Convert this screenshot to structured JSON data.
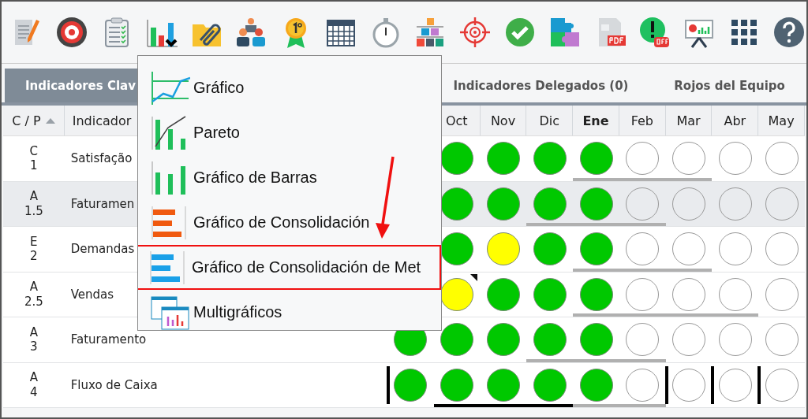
{
  "tabs": [
    {
      "label": "Indicadores Clav",
      "selected": true
    },
    {
      "label": "Indicadores Delegados (0)",
      "selected": false
    },
    {
      "label": "Rojos del Equipo",
      "selected": false
    }
  ],
  "table": {
    "columns": [
      {
        "label": "C / P",
        "sorted": true
      },
      {
        "label": "Indicador",
        "sorted": false
      }
    ],
    "months": [
      {
        "label": "Oct",
        "current": false
      },
      {
        "label": "Nov",
        "current": false
      },
      {
        "label": "Dic",
        "current": false
      },
      {
        "label": "Ene",
        "current": true
      },
      {
        "label": "Feb",
        "current": false
      },
      {
        "label": "Mar",
        "current": false
      },
      {
        "label": "Abr",
        "current": false
      },
      {
        "label": "May",
        "current": false
      }
    ],
    "rows": [
      {
        "category": "C",
        "priority": "1",
        "indicator": "Satisfação",
        "selected": false,
        "cells": [
          {
            "filled": true,
            "color": "#00c800"
          },
          {
            "filled": true,
            "color": "#00c800"
          },
          {
            "filled": true,
            "color": "#00c800"
          },
          {
            "filled": true,
            "color": "#00c800",
            "underline": true
          },
          {
            "filled": false,
            "underline": true
          },
          {
            "filled": false,
            "underline": true
          },
          {
            "filled": false
          },
          {
            "filled": false
          }
        ]
      },
      {
        "category": "A",
        "priority": "1.5",
        "indicator": "Faturamen",
        "selected": true,
        "cells": [
          {
            "filled": true,
            "color": "#00c800"
          },
          {
            "filled": true,
            "color": "#00c800"
          },
          {
            "filled": true,
            "color": "#00c800",
            "underline": true
          },
          {
            "filled": true,
            "color": "#00c800",
            "underline": true
          },
          {
            "filled": false,
            "underline": true
          },
          {
            "filled": false
          },
          {
            "filled": false
          },
          {
            "filled": false
          }
        ]
      },
      {
        "category": "E",
        "priority": "2",
        "indicator": "Demandas",
        "selected": false,
        "cells": [
          {
            "filled": true,
            "color": "#00c800"
          },
          {
            "filled": true,
            "color": "#ffff00"
          },
          {
            "filled": true,
            "color": "#00c800"
          },
          {
            "filled": true,
            "color": "#00c800",
            "underline": true
          },
          {
            "filled": false,
            "underline": true
          },
          {
            "filled": false,
            "underline": true
          },
          {
            "filled": false
          },
          {
            "filled": false
          }
        ]
      },
      {
        "category": "A",
        "priority": "2.5",
        "indicator": "Vendas",
        "selected": false,
        "cells": [
          {
            "filled": true,
            "color": "#ffff00",
            "flag": true
          },
          {
            "filled": true,
            "color": "#00c800"
          },
          {
            "filled": true,
            "color": "#00c800"
          },
          {
            "filled": true,
            "color": "#00c800",
            "underline": true
          },
          {
            "filled": false,
            "underline": true
          },
          {
            "filled": false,
            "underline": true
          },
          {
            "filled": false,
            "underline": true
          },
          {
            "filled": false
          }
        ]
      },
      {
        "category": "A",
        "priority": "3",
        "indicator": "Faturamento",
        "selected": false,
        "lead_cell": {
          "filled": true,
          "color": "#00c800"
        },
        "cells": [
          {
            "filled": true,
            "color": "#00c800"
          },
          {
            "filled": true,
            "color": "#00c800"
          },
          {
            "filled": true,
            "color": "#00c800",
            "underline": true
          },
          {
            "filled": true,
            "color": "#00c800",
            "underline": true
          },
          {
            "filled": false,
            "underline": true
          },
          {
            "filled": false
          },
          {
            "filled": false
          },
          {
            "filled": false
          }
        ]
      },
      {
        "category": "A",
        "priority": "4",
        "indicator": "Fluxo de Caixa",
        "selected": false,
        "lead_cell": {
          "filled": true,
          "color": "#00c800",
          "bar": true
        },
        "cells": [
          {
            "filled": true,
            "color": "#00c800",
            "strong_underline": true
          },
          {
            "filled": true,
            "color": "#00c800",
            "strong_underline": true
          },
          {
            "filled": true,
            "color": "#00c800",
            "strong_underline": true
          },
          {
            "filled": true,
            "color": "#00c800",
            "underline": true
          },
          {
            "filled": false,
            "underline": true
          },
          {
            "filled": false,
            "bar": true
          },
          {
            "filled": false,
            "bar": true
          },
          {
            "filled": false,
            "bar": true
          }
        ]
      }
    ]
  },
  "menu": {
    "items": [
      {
        "label": "Gráfico",
        "highlighted": false
      },
      {
        "label": "Pareto",
        "highlighted": false
      },
      {
        "label": "Gráfico de Barras",
        "highlighted": false
      },
      {
        "label": "Gráfico de Consolidación",
        "highlighted": false
      },
      {
        "label": "Gráfico de Consolidación de Met",
        "highlighted": true
      },
      {
        "label": "Multigráficos",
        "highlighted": false
      }
    ]
  }
}
